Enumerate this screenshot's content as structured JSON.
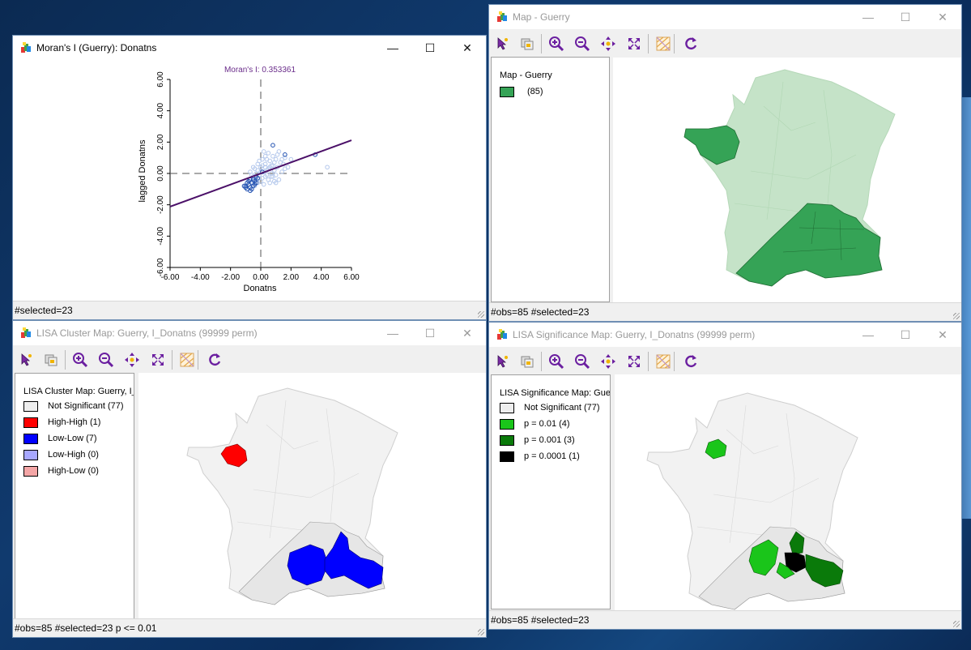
{
  "windows": {
    "moran": {
      "title": "Moran's I (Guerry): Donatns",
      "status": "#selected=23",
      "plot_title": "Moran's I: 0.353361"
    },
    "map": {
      "title": "Map - Guerry",
      "legend_title": "Map - Guerry",
      "legend_items": [
        {
          "label": "(85)",
          "color": "#35a356"
        }
      ],
      "status": "#obs=85 #selected=23"
    },
    "cluster": {
      "title": "LISA Cluster Map: Guerry, I_Donatns (99999 perm)",
      "legend_title": "LISA Cluster Map: Guerry, I_",
      "legend_items": [
        {
          "label": "Not Significant (77)",
          "color": "#eeeeee"
        },
        {
          "label": "High-High (1)",
          "color": "#ff0000"
        },
        {
          "label": "Low-Low (7)",
          "color": "#0000ff"
        },
        {
          "label": "Low-High (0)",
          "color": "#a7a7ff"
        },
        {
          "label": "High-Low (0)",
          "color": "#f4a6a6"
        }
      ],
      "status": "#obs=85 #selected=23   p <= 0.01"
    },
    "significance": {
      "title": "LISA Significance Map: Guerry, I_Donatns (99999 perm)",
      "legend_title": "LISA Significance Map: Gue",
      "legend_items": [
        {
          "label": "Not Significant (77)",
          "color": "#eeeeee"
        },
        {
          "label": "p = 0.01 (4)",
          "color": "#1ac51a"
        },
        {
          "label": "p = 0.001 (3)",
          "color": "#0a7a0a"
        },
        {
          "label": "p = 0.0001 (1)",
          "color": "#000000"
        }
      ],
      "status": "#obs=85 #selected=23"
    }
  },
  "toolbar_icons": [
    "select-icon",
    "copy-image-icon",
    "zoom-in-icon",
    "zoom-out-icon",
    "pan-icon",
    "full-extent-icon",
    "map-layer-icon",
    "refresh-icon"
  ],
  "window_controls": {
    "minimize": "—",
    "maximize": "☐",
    "close": "✕"
  },
  "chart_data": {
    "type": "scatter",
    "title": "Moran's I: 0.353361",
    "xlabel": "Donatns",
    "ylabel": "lagged Donatns",
    "xlim": [
      -6,
      6
    ],
    "ylim": [
      -6,
      6
    ],
    "xticks": [
      "-6.00",
      "-4.00",
      "-2.00",
      "0.00",
      "2.00",
      "4.00",
      "6.00"
    ],
    "yticks": [
      "-6.00",
      "-4.00",
      "-2.00",
      "0.00",
      "2.00",
      "4.00",
      "6.00"
    ],
    "slope": 0.353361,
    "regression_color": "#4b1068",
    "series": [
      {
        "role": "unselected",
        "color": "#b4c8ec",
        "points": [
          [
            -0.7,
            0.1
          ],
          [
            -0.5,
            -0.2
          ],
          [
            -0.4,
            0.3
          ],
          [
            -0.3,
            -0.4
          ],
          [
            -0.2,
            0.2
          ],
          [
            -0.1,
            -0.1
          ],
          [
            0.0,
            0.4
          ],
          [
            0.1,
            -0.3
          ],
          [
            0.2,
            0.1
          ],
          [
            0.3,
            0.6
          ],
          [
            0.4,
            -0.1
          ],
          [
            0.5,
            0.3
          ],
          [
            0.6,
            0.8
          ],
          [
            0.7,
            -0.2
          ],
          [
            0.8,
            0.5
          ],
          [
            0.9,
            0.2
          ],
          [
            1.0,
            0.9
          ],
          [
            1.1,
            0.4
          ],
          [
            1.2,
            -0.4
          ],
          [
            1.3,
            0.7
          ],
          [
            1.4,
            0.1
          ],
          [
            1.5,
            0.6
          ],
          [
            0.1,
            0.9
          ],
          [
            -0.2,
            0.6
          ],
          [
            0.3,
            1.1
          ],
          [
            -0.6,
            -0.5
          ],
          [
            -0.3,
            0.0
          ],
          [
            0.6,
            -0.6
          ],
          [
            0.9,
            -0.5
          ],
          [
            1.1,
            1.2
          ],
          [
            1.6,
            1.0
          ],
          [
            0.2,
            -0.7
          ],
          [
            0.5,
            1.3
          ],
          [
            -0.4,
            -0.8
          ],
          [
            0.0,
            -0.5
          ],
          [
            0.7,
            0.0
          ],
          [
            0.4,
            0.9
          ],
          [
            -0.1,
            0.8
          ],
          [
            1.8,
            0.4
          ],
          [
            1.2,
            1.4
          ],
          [
            0.8,
            1.1
          ],
          [
            -0.5,
            0.4
          ],
          [
            0.1,
            0.5
          ],
          [
            0.6,
            0.4
          ],
          [
            1.0,
            -0.1
          ],
          [
            0.3,
            -0.2
          ],
          [
            -0.2,
            -0.6
          ],
          [
            0.9,
            0.7
          ],
          [
            1.4,
            0.9
          ],
          [
            0.2,
            1.4
          ],
          [
            2.0,
            0.9
          ],
          [
            4.4,
            0.4
          ],
          [
            1.0,
            -0.6
          ],
          [
            0.4,
            0.2
          ],
          [
            -0.6,
            -0.1
          ],
          [
            0.5,
            -0.4
          ],
          [
            1.6,
            0.3
          ],
          [
            0.0,
            0.1
          ],
          [
            -0.3,
            -0.3
          ],
          [
            0.7,
            0.5
          ],
          [
            0.3,
            0.4
          ],
          [
            0.8,
            -0.2
          ]
        ]
      },
      {
        "role": "selected",
        "color": "#1f4fb0",
        "points": [
          [
            -1.0,
            -0.8
          ],
          [
            -0.9,
            -1.0
          ],
          [
            -0.8,
            -0.7
          ],
          [
            -0.7,
            -0.9
          ],
          [
            -0.6,
            -0.6
          ],
          [
            -0.5,
            -0.4
          ],
          [
            -0.4,
            -0.5
          ],
          [
            -1.1,
            -0.8
          ],
          [
            -0.3,
            -0.2
          ],
          [
            -0.9,
            -0.6
          ],
          [
            -0.6,
            -1.0
          ],
          [
            -0.2,
            -0.3
          ],
          [
            -0.8,
            -0.5
          ],
          [
            -0.4,
            -0.7
          ],
          [
            -0.7,
            -0.4
          ],
          [
            0.1,
            0.1
          ],
          [
            0.8,
            1.8
          ],
          [
            1.6,
            1.2
          ],
          [
            3.6,
            1.2
          ],
          [
            -1.0,
            -0.9
          ],
          [
            -0.5,
            -0.8
          ],
          [
            -0.3,
            -0.6
          ],
          [
            -0.7,
            -1.1
          ]
        ]
      }
    ]
  }
}
